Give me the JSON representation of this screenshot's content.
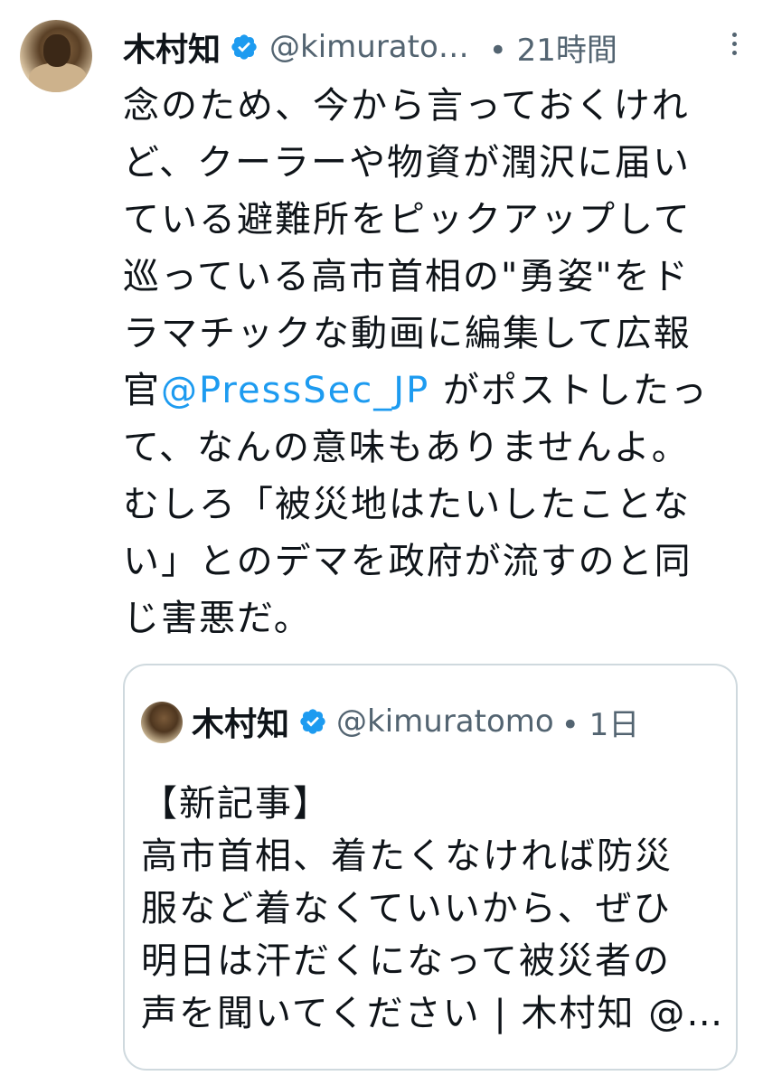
{
  "tweet": {
    "author_name": "木村知",
    "handle": "@kimurato…",
    "time": "• 21時間",
    "verified_icon": "verified-badge-icon",
    "more_icon": "more-vertical-icon",
    "text_lines": [
      "念のため、今から言っておくけれ",
      "ど、クーラーや物資が潤沢に届い",
      "ている避難所をピックアップして",
      "巡っている高市首相の\"勇姿\"をド",
      "ラマチックな動画に編集して広報"
    ],
    "line6_prefix": "官",
    "mention": "@PressSec_JP",
    "line6_suffix": " がポストしたっ",
    "text_lines_after": [
      "て、なんの意味もありませんよ。",
      "むしろ「被災地はたいしたことな",
      "い」とのデマを政府が流すのと同",
      "じ害悪だ。"
    ]
  },
  "quoted": {
    "author_name": "木村知",
    "handle": "@kimuratomo",
    "time": "• 1日",
    "text_lines": [
      "【新記事】",
      "高市首相、着たくなければ防災",
      "服など着なくていいから、ぜひ",
      "明日は汗だくになって被災者の",
      "声を聞いてください | 木村知 @…"
    ]
  },
  "colors": {
    "text": "#0f1419",
    "secondary": "#536471",
    "link": "#1d9bf0",
    "verified": "#1d9bf0",
    "border": "#cfd9de"
  }
}
